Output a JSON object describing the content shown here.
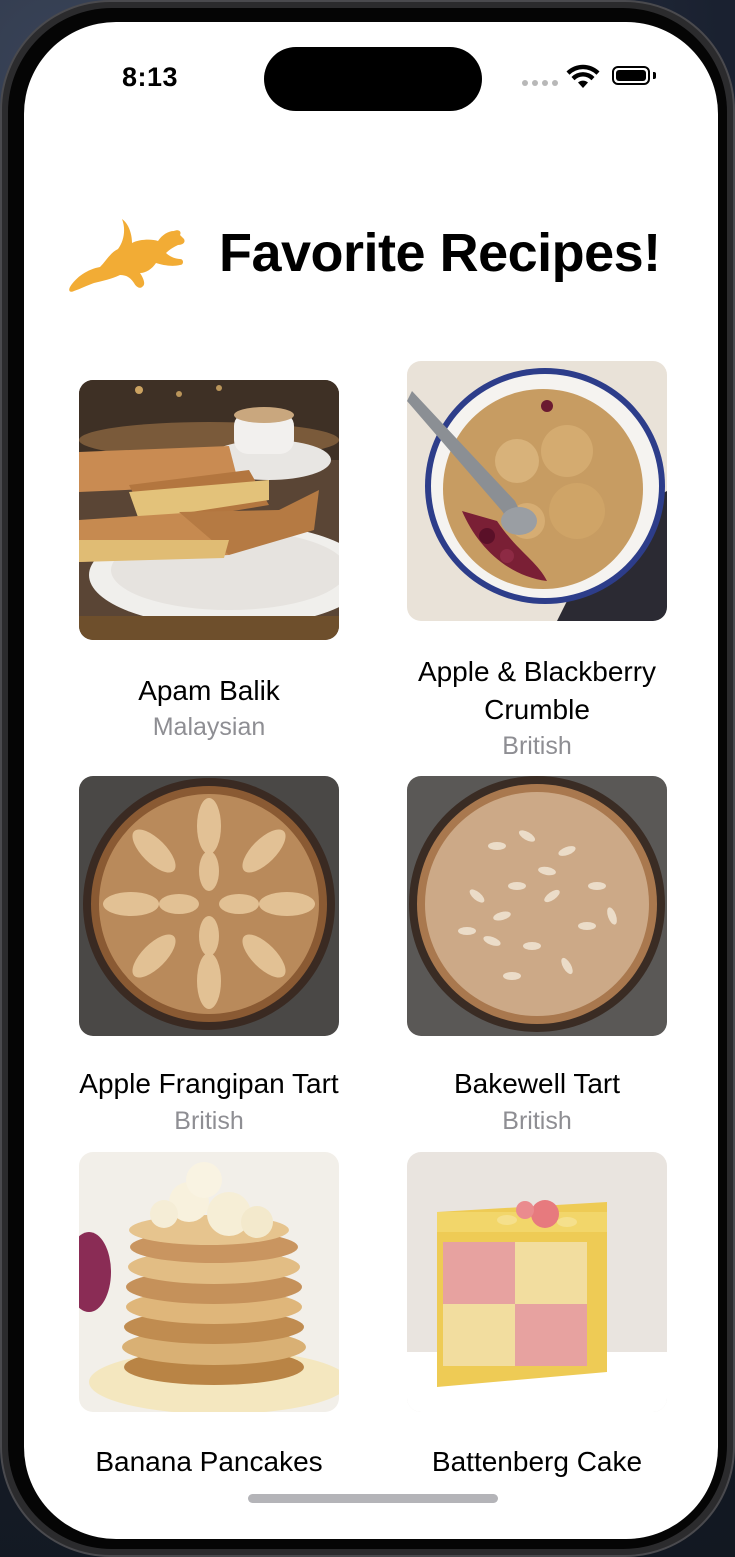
{
  "status_bar": {
    "time": "8:13"
  },
  "header": {
    "title": "Favorite Recipes!",
    "logo_icon": "dog-leaping-icon"
  },
  "recipes": [
    {
      "name": "Apam Balik",
      "cuisine": "Malaysian"
    },
    {
      "name": "Apple & Blackberry Crumble",
      "cuisine": "British"
    },
    {
      "name": "Apple Frangipan Tart",
      "cuisine": "British"
    },
    {
      "name": "Bakewell Tart",
      "cuisine": "British"
    },
    {
      "name": "Banana Pancakes",
      "cuisine": ""
    },
    {
      "name": "Battenberg Cake",
      "cuisine": ""
    }
  ],
  "colors": {
    "accent": "#f2ac35",
    "secondary_text": "#8e8e93"
  }
}
